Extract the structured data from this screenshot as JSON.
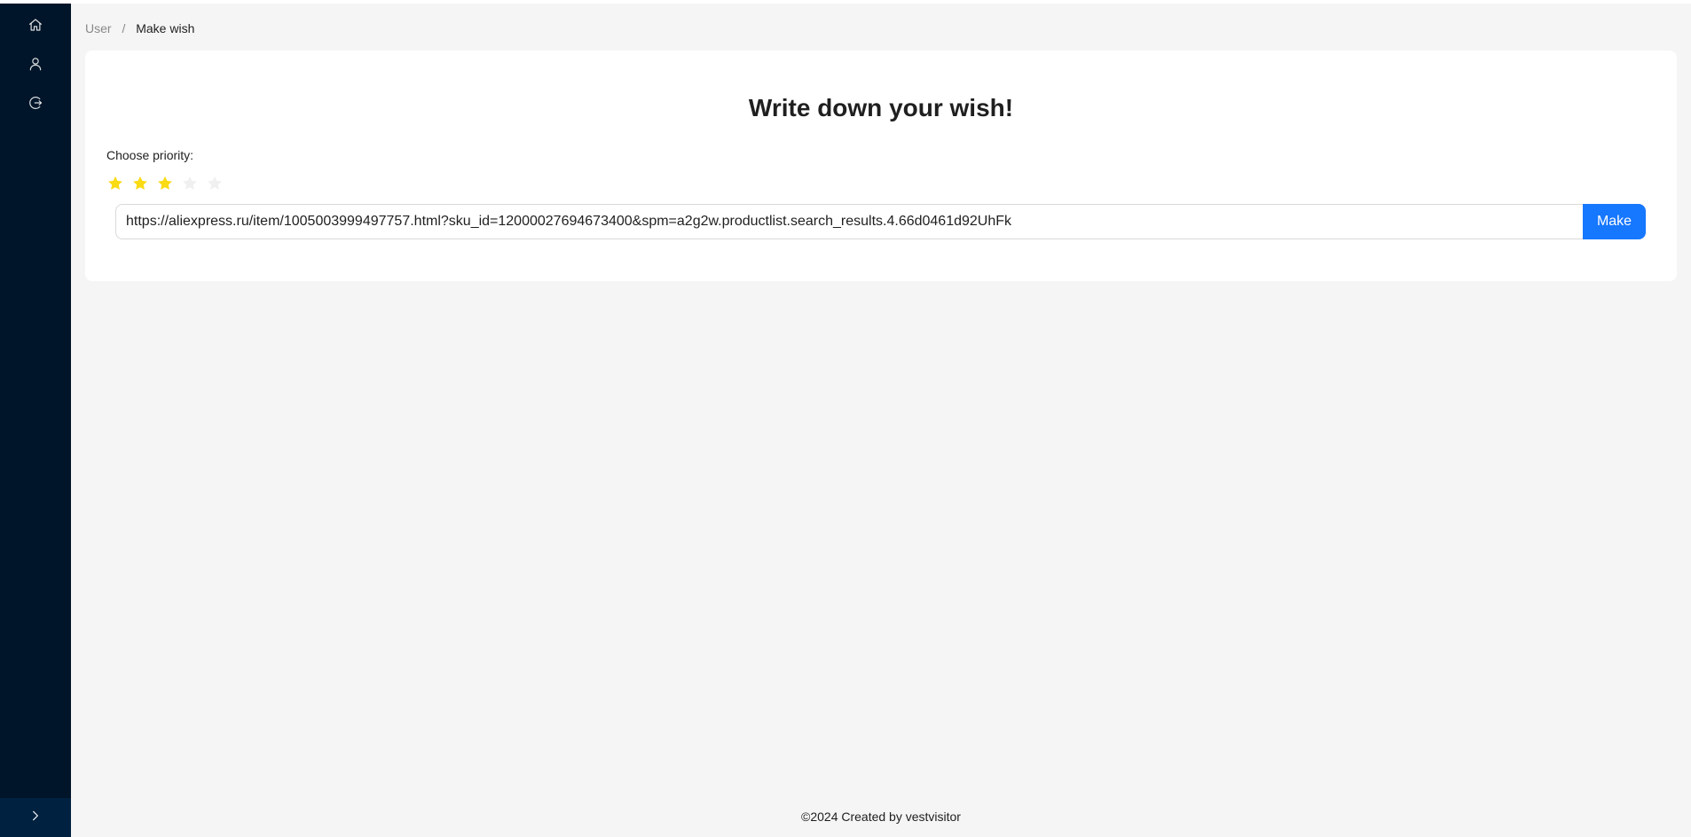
{
  "sidebar": {
    "items": [
      {
        "icon": "home-icon"
      },
      {
        "icon": "user-icon"
      },
      {
        "icon": "logout-icon"
      }
    ],
    "trigger_icon": "chevron-right-icon",
    "background": "#001529"
  },
  "breadcrumb": {
    "items": [
      "User",
      "Make wish"
    ],
    "separator": "/"
  },
  "main": {
    "title": "Write down your wish!",
    "priority_label": "Choose priority:",
    "rating": {
      "value": 3,
      "max": 5,
      "active_color": "#fadb14",
      "inactive_color": "#f0f0f0"
    },
    "url_input": {
      "value": "https://aliexpress.ru/item/1005003999497757.html?sku_id=12000027694673400&spm=a2g2w.productlist.search_results.4.66d0461d92UhFk"
    },
    "submit_label": "Make",
    "accent_color": "#1677ff"
  },
  "footer": {
    "text": "©2024 Created by vestvisitor"
  }
}
